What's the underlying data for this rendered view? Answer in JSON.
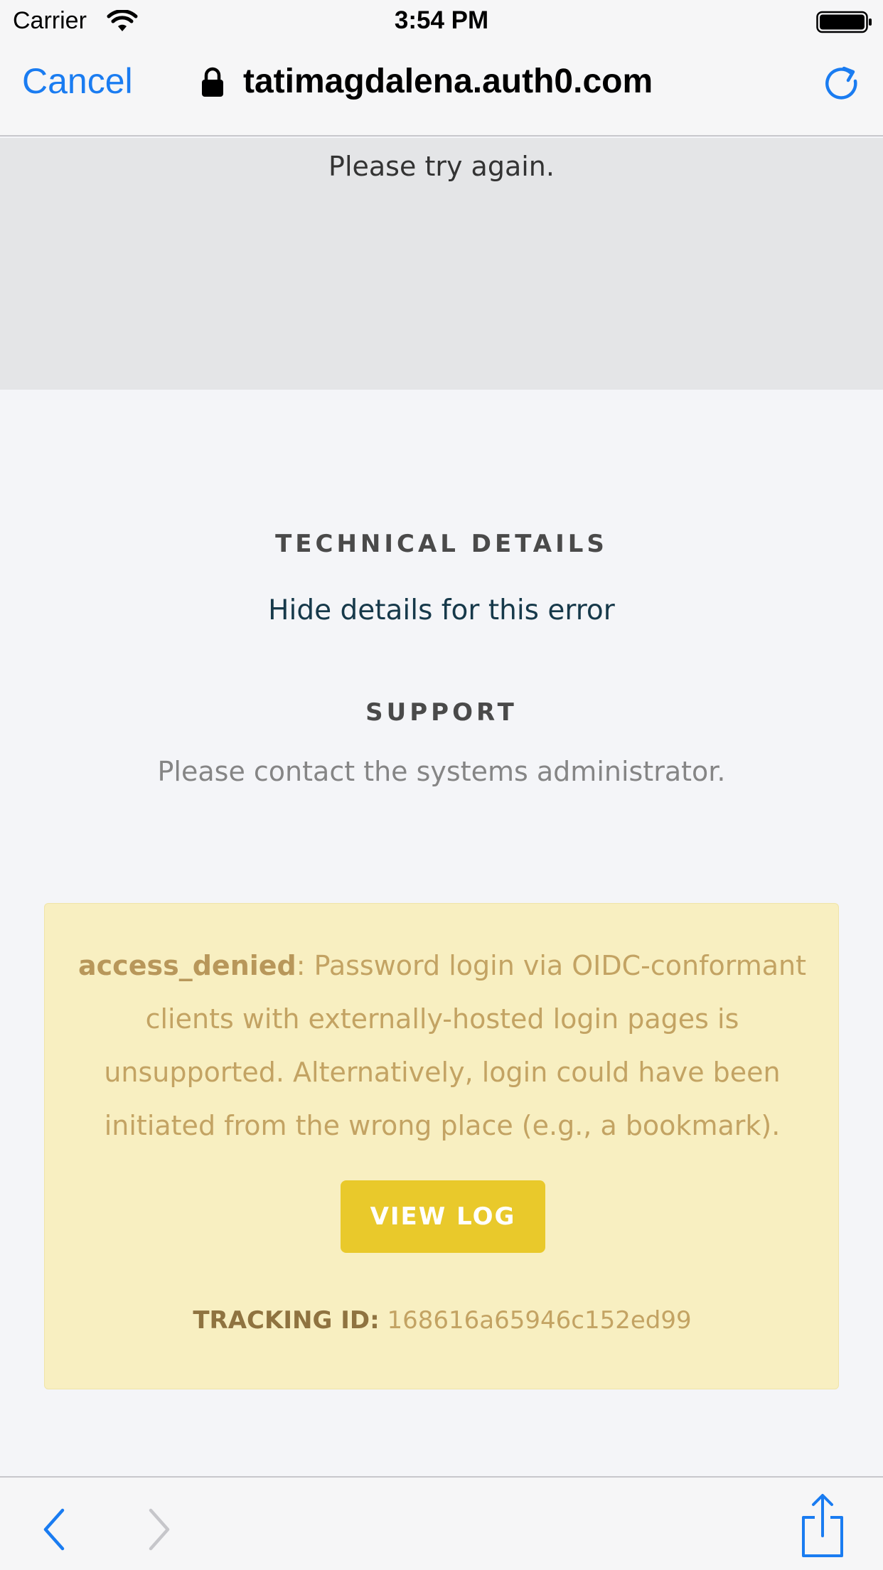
{
  "status_bar": {
    "carrier": "Carrier",
    "time": "3:54 PM",
    "icons": [
      "wifi-icon",
      "battery-icon"
    ]
  },
  "browser": {
    "cancel_label": "Cancel",
    "url": "tatimagdalena.auth0.com",
    "icons": [
      "lock-icon",
      "reload-icon"
    ],
    "accent_color": "#1a7cf1"
  },
  "page": {
    "try_again": "Please try again.",
    "technical_details_heading": "TECHNICAL DETAILS",
    "hide_details_link": "Hide details for this error",
    "support_heading": "SUPPORT",
    "support_text": "Please contact the systems administrator."
  },
  "error": {
    "code": "access_denied",
    "message": ": Password login via OIDC-conformant clients with externally-hosted login pages is unsupported. Alternatively, login could have been initiated from the wrong place (e.g., a bookmark).",
    "view_log_label": "VIEW LOG",
    "tracking_label": "TRACKING ID:",
    "tracking_id": "168616a65946c152ed99",
    "box_color": "#f8efc1",
    "button_color": "#e9c92b"
  },
  "toolbar": {
    "icons": [
      "back-icon",
      "forward-icon",
      "share-icon"
    ]
  }
}
